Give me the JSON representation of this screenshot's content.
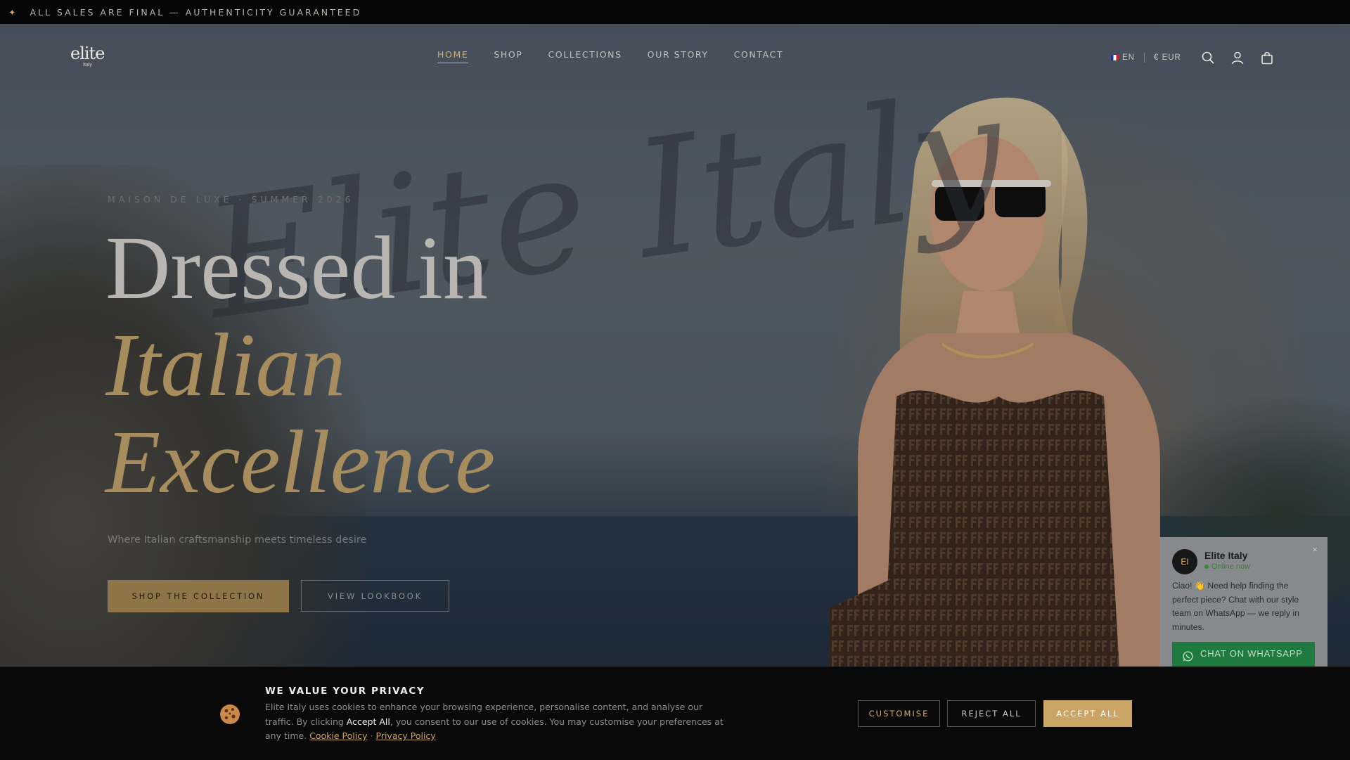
{
  "announcement": {
    "prefix_symbol": "✦",
    "text": "ALL SALES ARE FINAL — AUTHENTICITY GUARANTEED"
  },
  "brand": {
    "logo_word": "elite",
    "logo_sub": "Italy"
  },
  "nav": {
    "items": [
      {
        "label": "HOME",
        "active": true
      },
      {
        "label": "SHOP"
      },
      {
        "label": "COLLECTIONS"
      },
      {
        "label": "OUR STORY"
      },
      {
        "label": "CONTACT"
      }
    ],
    "language": "EN",
    "currency": "€ EUR",
    "icons": [
      "search-icon",
      "account-icon",
      "bag-icon"
    ]
  },
  "hero": {
    "watermark": "Elite Italy",
    "eyebrow": "MAISON DE LUXE · SUMMER 2026",
    "line1": "Dressed in",
    "line2": "Italian",
    "line3": "Excellence",
    "subtitle": "Where Italian craftsmanship meets timeless desire",
    "primary_cta": "SHOP THE COLLECTION",
    "secondary_cta": "VIEW LOOKBOOK"
  },
  "chat": {
    "avatar": "EI",
    "name": "Elite Italy",
    "status": "Online now",
    "message": "Ciao! 👋 Need help finding the perfect piece? Chat with our style team on WhatsApp — we reply in minutes.",
    "button": "CHAT ON WHATSAPP",
    "close": "×"
  },
  "cookie": {
    "title": "WE VALUE YOUR PRIVACY",
    "text_before": "Elite Italy uses cookies to enhance your browsing experience, personalise content, and analyse our traffic. By clicking ",
    "text_bold": "Accept All",
    "text_after": ", you consent to our use of cookies. You may customise your preferences at any time. ",
    "cookie_policy": "Cookie Policy",
    "separator": "·",
    "privacy_policy": "Privacy Policy",
    "customise": "CUSTOMISE",
    "reject": "REJECT ALL",
    "accept": "ACCEPT ALL"
  },
  "colors": {
    "gold": "#c9a465",
    "dark": "#0a0909",
    "whatsapp": "#1e7a3e"
  }
}
